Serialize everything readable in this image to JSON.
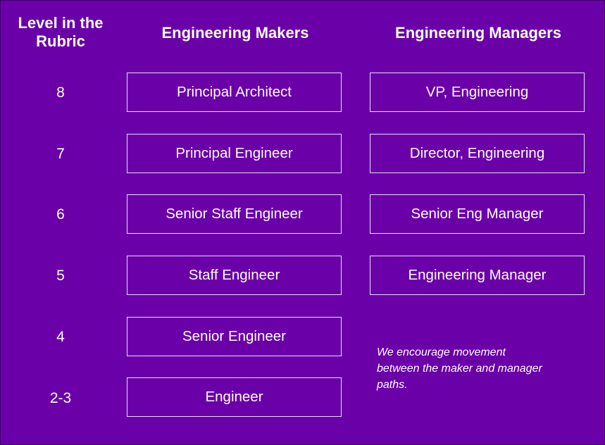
{
  "headers": {
    "level": "Level in the Rubric",
    "makers": "Engineering Makers",
    "managers": "Engineering Managers"
  },
  "rows": [
    {
      "level": "8",
      "maker": "Principal Architect",
      "manager": "VP, Engineering"
    },
    {
      "level": "7",
      "maker": "Principal Engineer",
      "manager": "Director, Engineering"
    },
    {
      "level": "6",
      "maker": "Senior Staff Engineer",
      "manager": "Senior Eng Manager"
    },
    {
      "level": "5",
      "maker": "Staff Engineer",
      "manager": "Engineering Manager"
    },
    {
      "level": "4",
      "maker": "Senior Engineer",
      "manager": ""
    },
    {
      "level": "2-3",
      "maker": "Engineer",
      "manager": ""
    }
  ],
  "note": "We encourage movement between the maker and manager paths.",
  "colors": {
    "background": "#6a00a8",
    "text": "#ffffff",
    "box_border": "#e8dcf2"
  }
}
